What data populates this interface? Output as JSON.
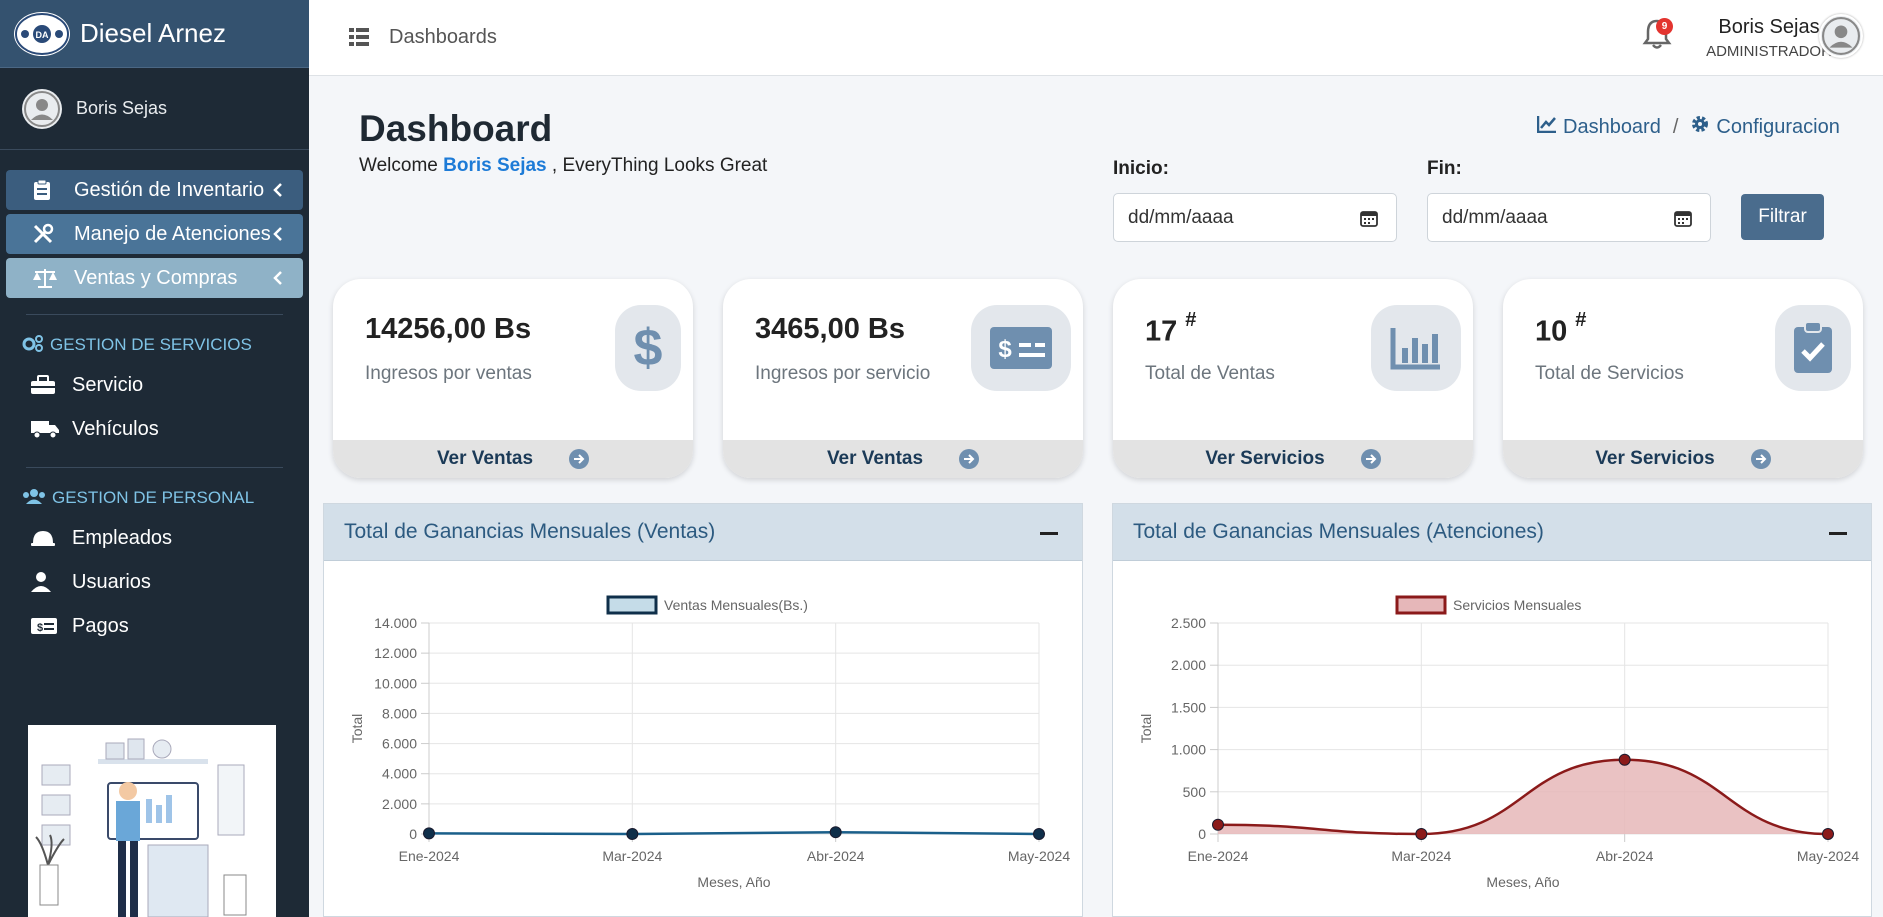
{
  "app": {
    "title": "Diesel Arnez",
    "logo_text": "DA"
  },
  "sidebar": {
    "user_name": "Boris Sejas",
    "main_items": [
      {
        "label": "Gestión de Inventario",
        "icon": "clipboard-icon"
      },
      {
        "label": "Manejo de Atenciones",
        "icon": "tools-icon"
      },
      {
        "label": "Ventas y Compras",
        "icon": "balance-scale-icon"
      }
    ],
    "section_servicios": "GESTION DE SERVICIOS",
    "servicios_items": [
      {
        "label": "Servicio",
        "icon": "toolbox-icon"
      },
      {
        "label": "Vehículos",
        "icon": "truck-icon"
      }
    ],
    "section_personal": "GESTION DE PERSONAL",
    "personal_items": [
      {
        "label": "Empleados",
        "icon": "hard-hat-icon"
      },
      {
        "label": "Usuarios",
        "icon": "user-icon"
      },
      {
        "label": "Pagos",
        "icon": "money-check-icon"
      }
    ]
  },
  "header": {
    "breadcrumb": "Dashboards",
    "notifications_count": "9",
    "user_name": "Boris Sejas",
    "user_role": "ADMINISTRADOR"
  },
  "page": {
    "title": "Dashboard",
    "welcome_prefix": "Welcome",
    "welcome_name": "Boris Sejas",
    "welcome_suffix": ", EveryThing Looks Great",
    "breadcrumb_dashboard": "Dashboard",
    "breadcrumb_sep": "/",
    "breadcrumb_config": "Configuracion"
  },
  "filters": {
    "inicio_label": "Inicio:",
    "inicio_placeholder": "dd/mm/aaaa",
    "fin_label": "Fin:",
    "fin_placeholder": "dd/mm/aaaa",
    "button": "Filtrar"
  },
  "cards": [
    {
      "value": "14256,00 Bs",
      "sup": "",
      "desc": "Ingresos por ventas",
      "link": "Ver Ventas",
      "icon": "dollar-icon"
    },
    {
      "value": "3465,00 Bs",
      "sup": "",
      "desc": "Ingresos por servicio",
      "link": "Ver Ventas",
      "icon": "money-check-icon"
    },
    {
      "value": "17",
      "sup": "#",
      "desc": "Total de Ventas",
      "link": "Ver Servicios",
      "icon": "chart-bar-icon"
    },
    {
      "value": "10",
      "sup": "#",
      "desc": "Total de Servicios",
      "link": "Ver Servicios",
      "icon": "clipboard-check-icon"
    }
  ],
  "panels": [
    {
      "title": "Total de Ganancias Mensuales (Ventas)"
    },
    {
      "title": "Total de Ganancias Mensuales (Atenciones)"
    }
  ],
  "colors": {
    "sales_line": "#1a5f8a",
    "sales_fill": "#c5dce8",
    "services_line": "#8b1a1a",
    "services_fill": "#e6b7b9"
  },
  "chart_data": [
    {
      "type": "line",
      "title": "",
      "xlabel": "Meses, Año",
      "ylabel": "Total",
      "categories": [
        "Ene-2024",
        "Mar-2024",
        "Abr-2024",
        "May-2024"
      ],
      "yticks": [
        "0",
        "2.000",
        "4.000",
        "6.000",
        "8.000",
        "10.000",
        "12.000",
        "14.000"
      ],
      "ylim": [
        0,
        14000
      ],
      "grid": true,
      "legend_position": "top",
      "series": [
        {
          "name": "Ventas Mensuales(Bs.)",
          "values": [
            40,
            0,
            120,
            0
          ]
        }
      ]
    },
    {
      "type": "area",
      "title": "",
      "xlabel": "Meses, Año",
      "ylabel": "Total",
      "categories": [
        "Ene-2024",
        "Mar-2024",
        "Abr-2024",
        "May-2024"
      ],
      "yticks": [
        "0",
        "500",
        "1.000",
        "1.500",
        "2.000",
        "2.500"
      ],
      "ylim": [
        0,
        2500
      ],
      "grid": true,
      "legend_position": "top",
      "series": [
        {
          "name": "Servicios Mensuales",
          "values": [
            110,
            0,
            880,
            0
          ]
        }
      ]
    }
  ]
}
